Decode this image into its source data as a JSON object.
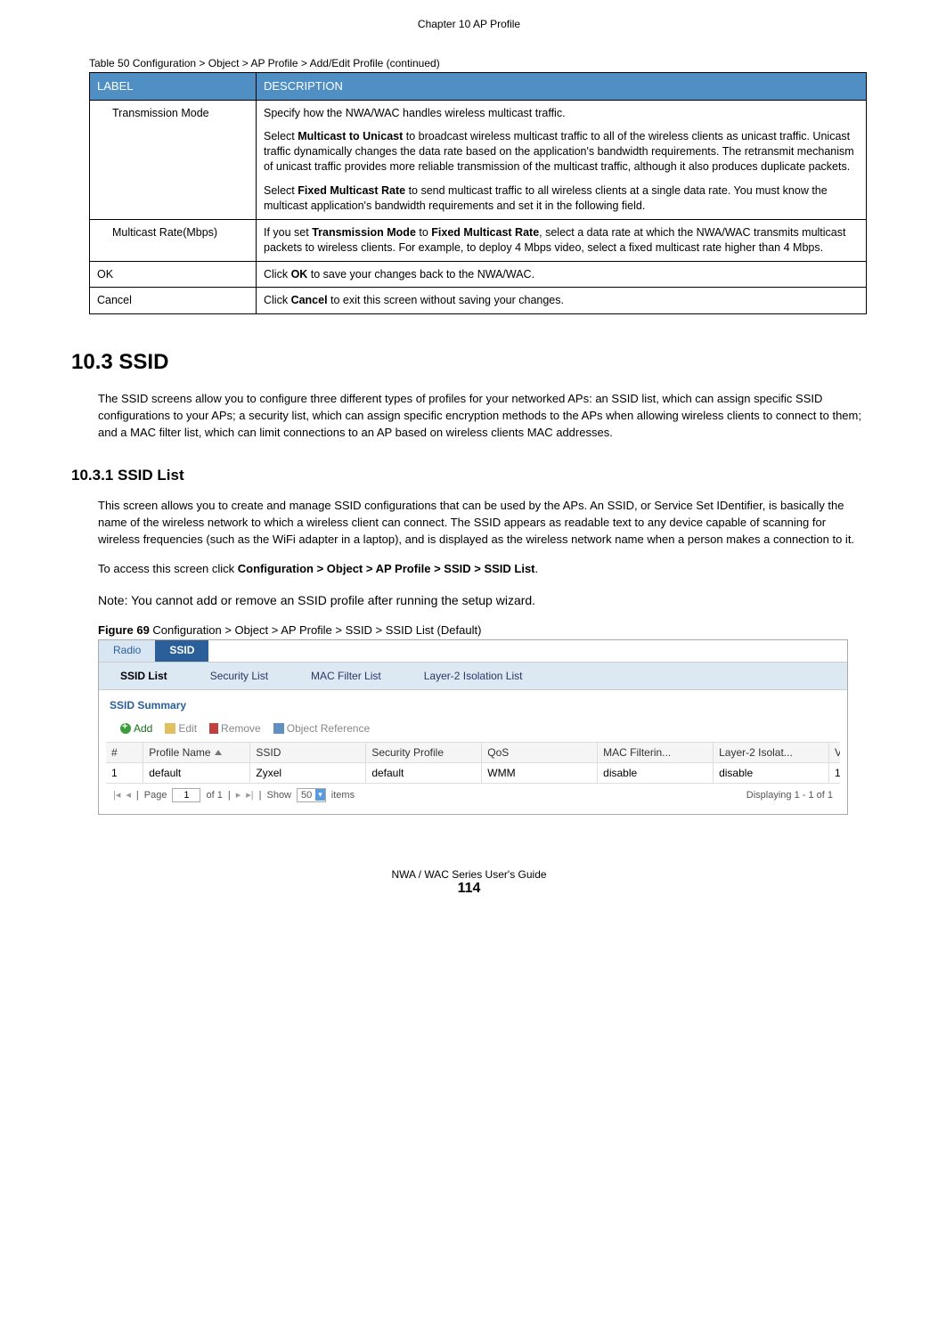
{
  "chapter_header": "Chapter 10 AP Profile",
  "table_caption": "Table 50   Configuration > Object > AP Profile > Add/Edit Profile (continued)",
  "table_headers": {
    "label": "LABEL",
    "description": "DESCRIPTION"
  },
  "rows": [
    {
      "label": "Transmission Mode",
      "indent": true,
      "desc_parts": [
        {
          "segments": [
            {
              "t": "Specify how the NWA/WAC handles wireless multicast traffic."
            }
          ]
        },
        {
          "segments": [
            {
              "t": "Select "
            },
            {
              "b": true,
              "t": "Multicast to Unicast"
            },
            {
              "t": " to broadcast wireless multicast traffic to all of the wireless clients as unicast traffic. Unicast traffic dynamically changes the data rate based on the application's bandwidth requirements. The retransmit mechanism of unicast traffic provides more reliable transmission of the multicast traffic, although it also produces duplicate packets."
            }
          ]
        },
        {
          "segments": [
            {
              "t": "Select "
            },
            {
              "b": true,
              "t": "Fixed Multicast Rate"
            },
            {
              "t": " to send multicast traffic to all wireless clients at a single data rate. You must know the multicast application's bandwidth requirements and set it in the following field."
            }
          ]
        }
      ]
    },
    {
      "label": "Multicast Rate(Mbps)",
      "indent": true,
      "desc_parts": [
        {
          "segments": [
            {
              "t": "If you set "
            },
            {
              "b": true,
              "t": "Transmission Mode"
            },
            {
              "t": " to "
            },
            {
              "b": true,
              "t": "Fixed Multicast Rate"
            },
            {
              "t": ", select a data rate at which the NWA/WAC transmits multicast packets to wireless clients. For example, to deploy 4 Mbps video, select a fixed multicast rate higher than 4 Mbps."
            }
          ]
        }
      ]
    },
    {
      "label": "OK",
      "indent": false,
      "desc_parts": [
        {
          "segments": [
            {
              "t": "Click "
            },
            {
              "b": true,
              "t": "OK"
            },
            {
              "t": " to save your changes back to the NWA/WAC."
            }
          ]
        }
      ]
    },
    {
      "label": "Cancel",
      "indent": false,
      "desc_parts": [
        {
          "segments": [
            {
              "t": "Click "
            },
            {
              "b": true,
              "t": "Cancel"
            },
            {
              "t": " to exit this screen without saving your changes."
            }
          ]
        }
      ]
    }
  ],
  "section_heading": "10.3  SSID",
  "section_body": "The SSID screens allow you to configure three different types of profiles for your networked APs: an SSID list, which can assign specific SSID configurations to your APs; a security list, which can assign specific encryption methods to the APs when allowing wireless clients to connect to them; and a MAC filter list, which can limit connections to an AP based on wireless clients MAC addresses.",
  "subsection_heading": "10.3.1  SSID List",
  "subsection_body1": "This screen allows you to create and manage SSID configurations that can be used by the APs. An SSID, or Service Set IDentifier, is basically the name of the wireless network to which a wireless client can connect. The SSID appears as readable text to any device capable of scanning for wireless frequencies (such as the WiFi adapter in a laptop), and is displayed as the wireless network name when a person makes a connection to it.",
  "subsection_body2_prefix": "To access this screen click ",
  "subsection_body2_bold": "Configuration > Object > AP Profile > SSID > SSID List",
  "subsection_body2_suffix": ".",
  "note_text": "Note: You cannot add or remove an SSID profile after running the setup wizard.",
  "figure_caption_prefix": "Figure 69",
  "figure_caption_rest": "   Configuration > Object > AP Profile > SSID > SSID List (Default)",
  "screenshot": {
    "tabs": [
      "Radio",
      "SSID"
    ],
    "active_tab": 1,
    "subtabs": [
      "SSID List",
      "Security List",
      "MAC Filter List",
      "Layer-2 Isolation List"
    ],
    "active_subtab": 0,
    "panel_title": "SSID Summary",
    "toolbar": {
      "add": "Add",
      "edit": "Edit",
      "remove": "Remove",
      "objref": "Object Reference"
    },
    "grid_headers": {
      "num": "#",
      "profile": "Profile Name",
      "ssid": "SSID",
      "sec": "Security Profile",
      "qos": "QoS",
      "mac": "MAC Filterin...",
      "l2": "Layer-2 Isolat...",
      "vlan": "VLAN ID"
    },
    "grid_rows": [
      {
        "num": "1",
        "profile": "default",
        "ssid": "Zyxel",
        "sec": "default",
        "qos": "WMM",
        "mac": "disable",
        "l2": "disable",
        "vlan": "1"
      }
    ],
    "pager": {
      "page_label": "Page",
      "page_value": "1",
      "of_label": "of 1",
      "show_label": "Show",
      "show_value": "50",
      "items_label": "items",
      "display_label": "Displaying 1 - 1 of 1"
    }
  },
  "footer_guide": "NWA / WAC Series User's Guide",
  "footer_page": "114"
}
